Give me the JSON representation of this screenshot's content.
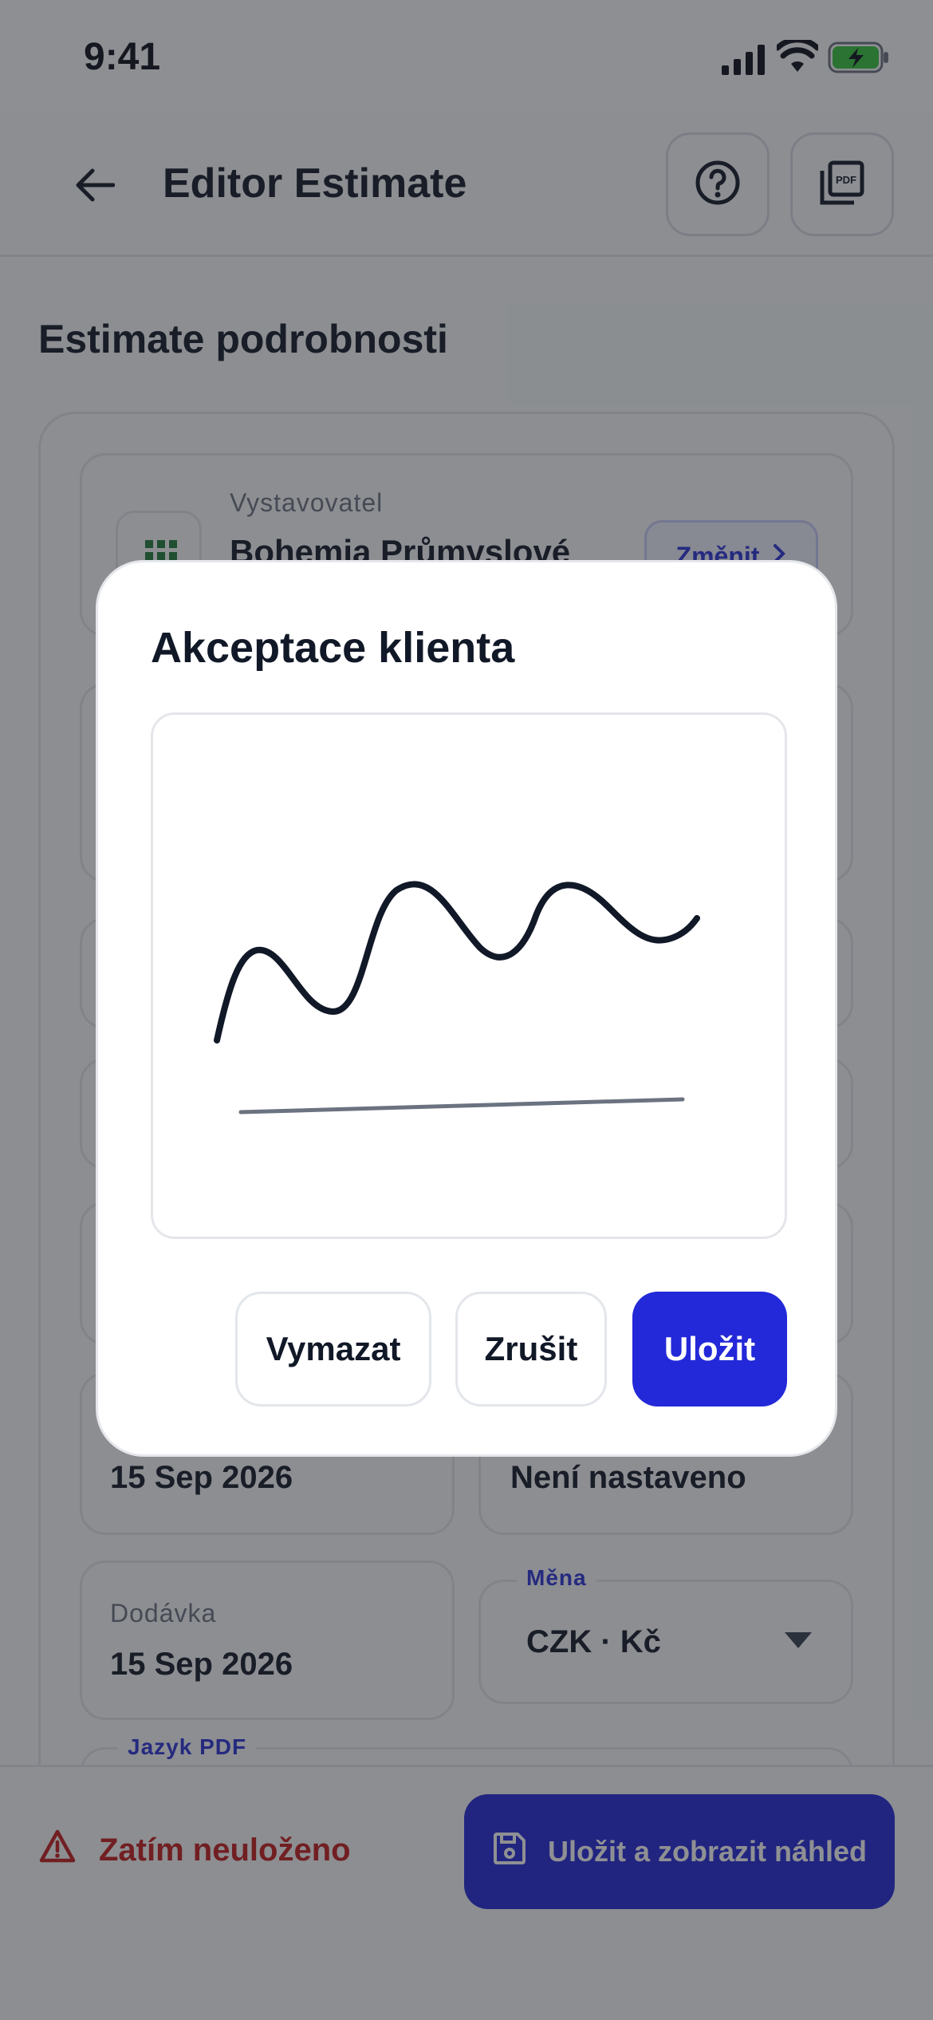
{
  "status_bar": {
    "time": "9:41"
  },
  "header": {
    "title": "Editor Estimate",
    "help_icon": "question-circle-icon",
    "pdf_icon": "pdf-file-icon"
  },
  "section": {
    "title": "Estimate podrobnosti"
  },
  "issuer": {
    "label": "Vystavovatel",
    "name": "Bohemia Průmyslové",
    "change_label": "Změnit"
  },
  "fields": {
    "date_value": "15 Sep 2026",
    "not_set_value": "Není nastaveno",
    "delivery_label": "Dodávka",
    "delivery_value": "15 Sep 2026",
    "currency_label": "Měna",
    "currency_value": "CZK · Kč",
    "pdf_language_label": "Jazyk PDF"
  },
  "bottom": {
    "unsaved_label": "Zatím neuloženo",
    "save_preview_label": "Uložit a zobrazit náhled"
  },
  "dialog": {
    "title": "Akceptace klienta",
    "clear_label": "Vymazat",
    "cancel_label": "Zrušit",
    "save_label": "Uložit"
  },
  "colors": {
    "primary": "#2329d8",
    "danger": "#c21d1d",
    "text": "#111827",
    "overlay": "rgba(31,34,39,0.5)"
  }
}
